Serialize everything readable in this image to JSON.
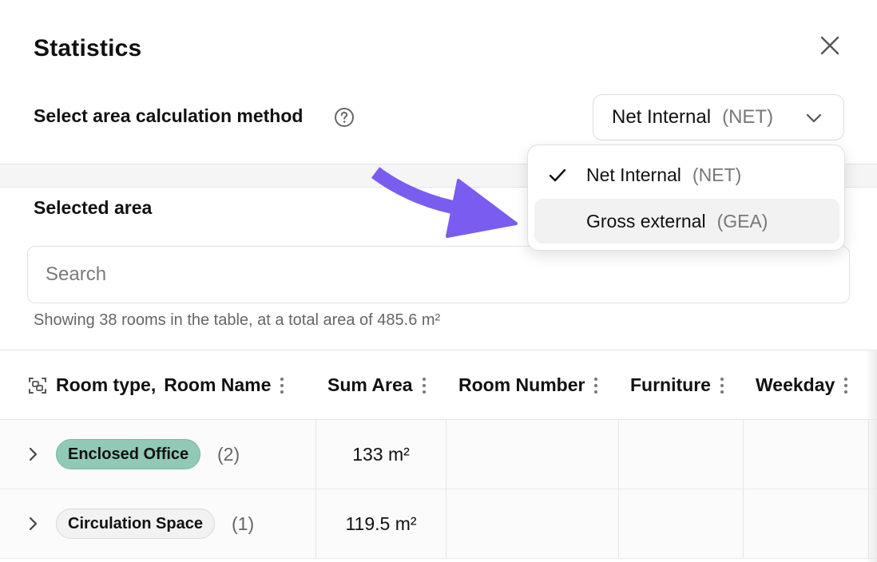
{
  "header": {
    "title": "Statistics"
  },
  "method": {
    "label": "Select area calculation method",
    "selected_main": "Net Internal",
    "selected_abbr": "(NET)",
    "options": [
      {
        "main": "Net Internal",
        "abbr": "(NET)",
        "checked": true
      },
      {
        "main": "Gross external",
        "abbr": "(GEA)",
        "checked": false
      }
    ]
  },
  "selected_area": {
    "title": "Selected area",
    "search_placeholder": "Search",
    "summary": "Showing 38 rooms in the table, at a total area of 485.6 m²"
  },
  "table": {
    "columns": [
      "Room type,",
      "Room Name",
      "Sum Area",
      "Room Number",
      "Furniture",
      "Weekday"
    ],
    "rows": [
      {
        "tag": "Enclosed Office",
        "count": "(2)",
        "area": "133 m²",
        "tag_color": "#90c9b5"
      },
      {
        "tag": "Circulation Space",
        "count": "(1)",
        "area": "119.5 m²",
        "tag_color": "#f2f2f2"
      }
    ]
  },
  "colors": {
    "arrow": "#7b5cf0",
    "accent_green": "#90c9b5"
  }
}
